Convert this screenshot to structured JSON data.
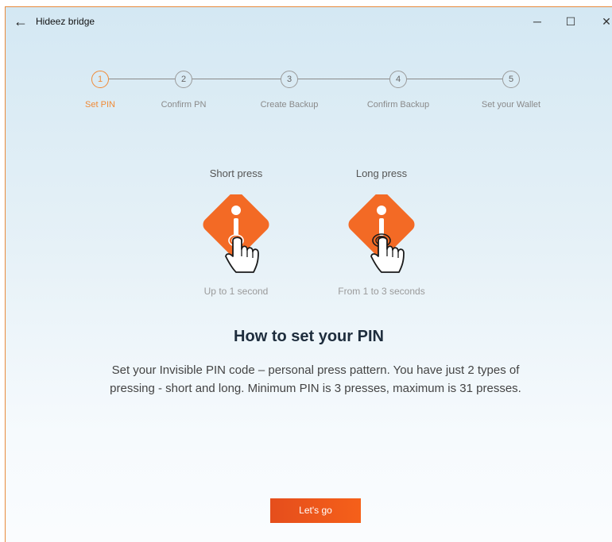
{
  "titlebar": {
    "app_title": "Hideez bridge",
    "back_glyph": "←",
    "minimize_glyph": "─",
    "maximize_glyph": "☐",
    "close_glyph": "✕"
  },
  "stepper": {
    "steps": [
      {
        "number": "1",
        "label": "Set PIN",
        "active": true
      },
      {
        "number": "2",
        "label": "Confirm PN",
        "active": false
      },
      {
        "number": "3",
        "label": "Create Backup",
        "active": false
      },
      {
        "number": "4",
        "label": "Confirm Backup",
        "active": false
      },
      {
        "number": "5",
        "label": "Set your Wallet",
        "active": false
      }
    ]
  },
  "press_types": {
    "short": {
      "title": "Short press",
      "hint": "Up to 1 second"
    },
    "long": {
      "title": "Long press",
      "hint": "From 1 to 3 seconds"
    }
  },
  "main": {
    "heading": "How to set your PIN",
    "description": "Set your Invisible PIN code – personal press pattern. You have just 2 types of pressing - short and long. Minimum PIN is 3 presses, maximum is 31 presses."
  },
  "cta": {
    "label": "Let's go"
  },
  "colors": {
    "accent": "#f08a36",
    "button": "#f15a1e",
    "device": "#f36a25"
  },
  "icons": {
    "back": "back-arrow-icon",
    "device": "hideez-key-icon",
    "hand": "hand-pointer-icon"
  }
}
